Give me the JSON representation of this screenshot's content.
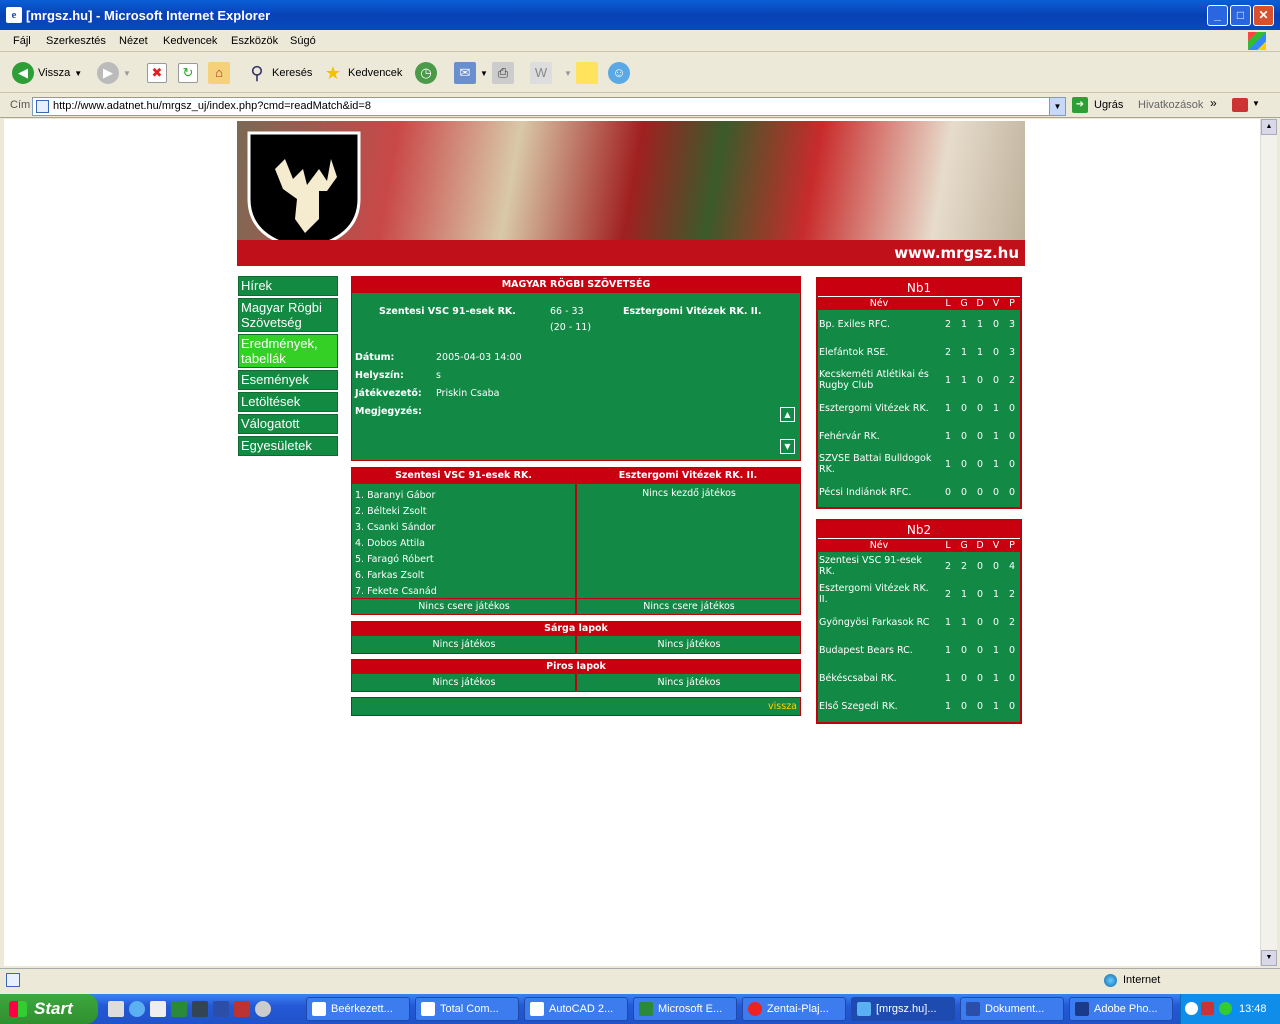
{
  "window": {
    "title": "[mrgsz.hu] - Microsoft Internet Explorer"
  },
  "menu": [
    "Fájl",
    "Szerkesztés",
    "Nézet",
    "Kedvencek",
    "Eszközök",
    "Súgó"
  ],
  "toolbar": {
    "back": "Vissza",
    "search": "Keresés",
    "favorites": "Kedvencek"
  },
  "address": {
    "label": "Cím",
    "url": "http://www.adatnet.hu/mrgsz_uj/index.php?cmd=readMatch&id=8",
    "go": "Ugrás",
    "links": "Hivatkozások"
  },
  "status": {
    "zone": "Internet"
  },
  "banner": {
    "url": "www.mrgsz.hu"
  },
  "nav": [
    "Hírek",
    "Magyar Rögbi Szövetség",
    "Eredmények, tabellák",
    "Események",
    "Letöltések",
    "Válogatott",
    "Egyesületek"
  ],
  "match": {
    "header": "MAGYAR RÖGBI SZÖVETSÉG",
    "home": "Szentesi VSC 91-esek RK.",
    "away": "Esztergomi Vitézek RK. II.",
    "score": "66  - 33",
    "halftime": "(20 - 11)",
    "date_label": "Dátum:",
    "date": "2005-04-03 14:00",
    "venue_label": "Helyszín:",
    "venue": "s",
    "referee_label": "Játékvezető:",
    "referee": "Priskin Csaba",
    "note_label": "Megjegyzés:"
  },
  "lineups": {
    "home_players": [
      "1. Baranyi Gábor",
      "2. Bélteki Zsolt",
      "3. Csanki Sándor",
      "4. Dobos Attila",
      "5. Faragó Róbert",
      "6. Farkas Zsolt",
      "7. Fekete Csanád"
    ],
    "away_players_empty": "Nincs kezdő játékos",
    "home_subs": "Nincs csere játékos",
    "away_subs": "Nincs csere játékos"
  },
  "yellow": {
    "title": "Sárga lapok",
    "home": "Nincs játékos",
    "away": "Nincs játékos"
  },
  "red": {
    "title": "Piros lapok",
    "home": "Nincs játékos",
    "away": "Nincs játékos"
  },
  "back_link": "vissza",
  "nb1": {
    "title": "Nb1",
    "cols": [
      "Név",
      "L",
      "G",
      "D",
      "V",
      "P"
    ],
    "rows": [
      [
        "Bp. Exiles RFC.",
        "2",
        "1",
        "1",
        "0",
        "3"
      ],
      [
        "Elefántok RSE.",
        "2",
        "1",
        "1",
        "0",
        "3"
      ],
      [
        "Kecskeméti Atlétikai és Rugby Club",
        "1",
        "1",
        "0",
        "0",
        "2"
      ],
      [
        "Esztergomi Vitézek RK.",
        "1",
        "0",
        "0",
        "1",
        "0"
      ],
      [
        "Fehérvár RK.",
        "1",
        "0",
        "0",
        "1",
        "0"
      ],
      [
        "SZVSE Battai Bulldogok RK.",
        "1",
        "0",
        "0",
        "1",
        "0"
      ],
      [
        "Pécsi Indiánok RFC.",
        "0",
        "0",
        "0",
        "0",
        "0"
      ]
    ]
  },
  "nb2": {
    "title": "Nb2",
    "cols": [
      "Név",
      "L",
      "G",
      "D",
      "V",
      "P"
    ],
    "rows": [
      [
        "Szentesi VSC 91-esek RK.",
        "2",
        "2",
        "0",
        "0",
        "4"
      ],
      [
        "Esztergomi Vitézek RK. II.",
        "2",
        "1",
        "0",
        "1",
        "2"
      ],
      [
        "Gyöngyösi Farkasok RC",
        "1",
        "1",
        "0",
        "0",
        "2"
      ],
      [
        "Budapest Bears RC.",
        "1",
        "0",
        "0",
        "1",
        "0"
      ],
      [
        "Békéscsabai RK.",
        "1",
        "0",
        "0",
        "1",
        "0"
      ],
      [
        "Első Szegedi RK.",
        "1",
        "0",
        "0",
        "1",
        "0"
      ]
    ]
  },
  "taskbar": {
    "start": "Start",
    "time": "13:48",
    "tasks": [
      "Beérkezett...",
      "Total Com...",
      "AutoCAD 2...",
      "Microsoft E...",
      "Zentai-Plaj...",
      "[mrgsz.hu]...",
      "Dokument...",
      "Adobe Pho..."
    ]
  }
}
